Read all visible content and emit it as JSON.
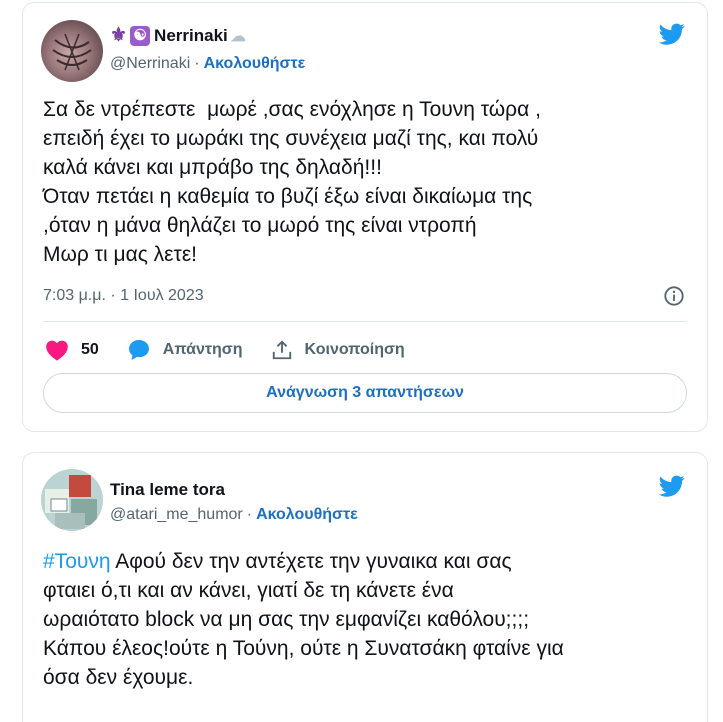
{
  "tweets": [
    {
      "display_name": "Nerrinaki",
      "handle": "@Nerrinaki",
      "follow_label": "Ακολουθήστε",
      "text": "Σα δε ντρέπεστε  μωρέ ,σας ενόχλησε η Τουνη τώρα ,\nεπειδή έχει το μωράκι της συνέχεια μαζί της, και πολύ\nκαλά κάνει και μπράβο της δηλαδή!!!\nΌταν πετάει η καθεμία το βυζί έξω είναι δικαίωμα της\n,όταν η μάνα θηλάζει το μωρό της είναι ντροπή\nΜωρ τι μας λετε!",
      "timestamp": "7:03 μ.μ. · 1 Ιουλ 2023",
      "likes": "50",
      "reply_label": "Απάντηση",
      "share_label": "Κοινοποίηση",
      "read_replies_label": "Ανάγνωση 3 απαντήσεων"
    },
    {
      "display_name": "Tina leme tora",
      "handle": "@atari_me_humor",
      "follow_label": "Ακολουθήστε",
      "hashtag": "#Τουνη",
      "text": " Αφού δεν την αντέχετε την γυναικα και σας\nφταιει ό,τι και αν κάνει, γιατί δε τη κάνετε ένα\nωραιότατο block να μη σας την εμφανίζει καθόλου;;;;\nΚάπου έλεος!ούτε η Τούνη, ούτε η Συνατσάκη φταίνε για\nόσα δεν έχουμε."
    }
  ],
  "colors": {
    "like": "#f91880",
    "link": "#1d6fc4",
    "twitter": "#1d9bf0",
    "muted": "#536471"
  }
}
